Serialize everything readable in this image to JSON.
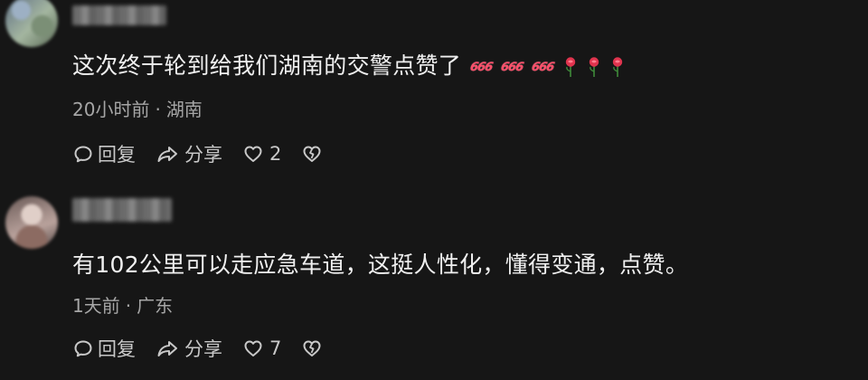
{
  "comments": [
    {
      "text": "这次终于轮到给我们湖南的交警点赞了",
      "emojis": [
        "666",
        "666",
        "666",
        "rose",
        "rose",
        "rose"
      ],
      "time": "20小时前",
      "location": "湖南",
      "reply_label": "回复",
      "share_label": "分享",
      "likes": "2"
    },
    {
      "text": "有102公里可以走应急车道，这挺人性化，懂得变通，点赞。",
      "time": "1天前",
      "location": "广东",
      "reply_label": "回复",
      "share_label": "分享",
      "likes": "7"
    }
  ],
  "meta_separator": "·",
  "colors": {
    "background": "#161616",
    "text_primary": "#f0f0f0",
    "text_secondary": "#a6a6a6",
    "emoji_666": "#ff4f6a"
  },
  "icons": [
    "reply-icon",
    "share-icon",
    "heart-icon",
    "dislike-heart-icon",
    "avatar",
    "rose-emoji"
  ]
}
